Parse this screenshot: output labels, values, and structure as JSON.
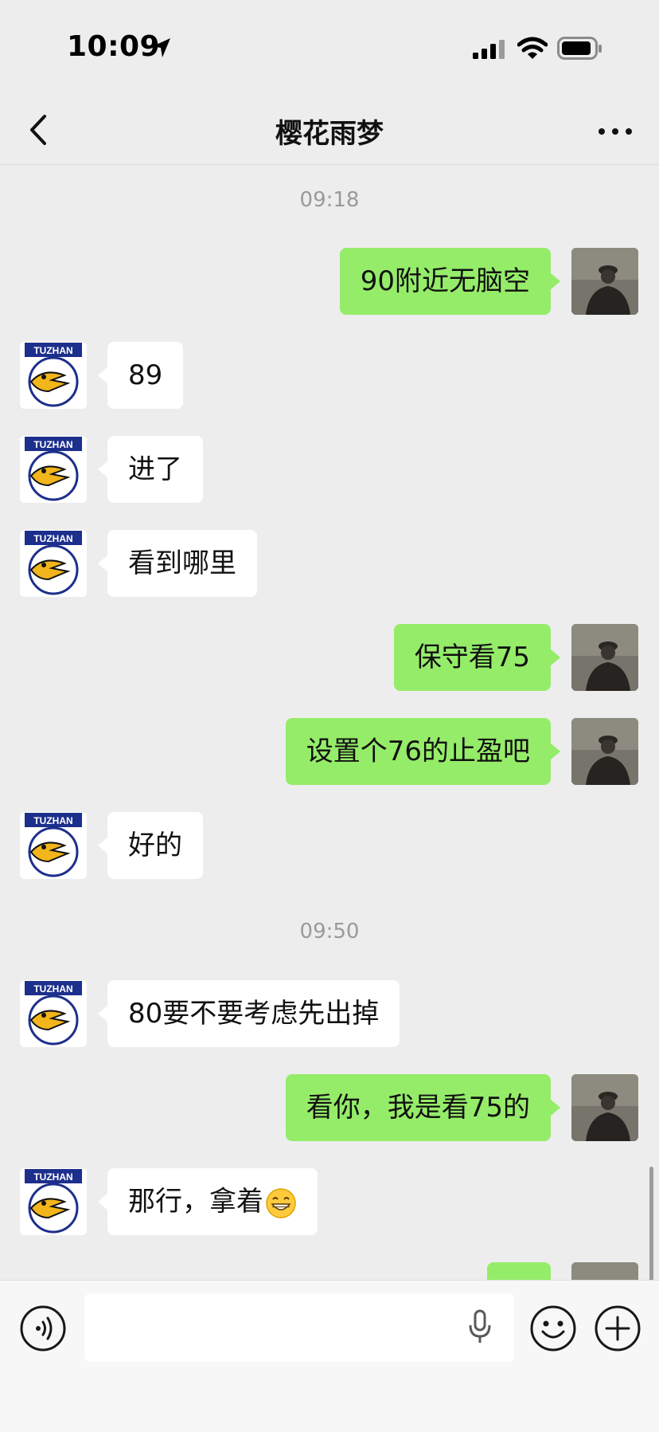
{
  "status": {
    "time": "10:09"
  },
  "header": {
    "title": "樱花雨梦"
  },
  "avatars": {
    "left_label": "TUZHAN"
  },
  "messages": [
    {
      "type": "time",
      "text": "09:18"
    },
    {
      "type": "sent",
      "text": "90附近无脑空"
    },
    {
      "type": "received",
      "text": "89"
    },
    {
      "type": "received",
      "text": "进了"
    },
    {
      "type": "received",
      "text": "看到哪里"
    },
    {
      "type": "sent",
      "text": "保守看75"
    },
    {
      "type": "sent",
      "text": "设置个76的止盈吧"
    },
    {
      "type": "received",
      "text": "好的"
    },
    {
      "type": "time",
      "text": "09:50"
    },
    {
      "type": "received",
      "text": "80要不要考虑先出掉"
    },
    {
      "type": "sent",
      "text": "看你，我是看75的"
    },
    {
      "type": "received",
      "text": "那行，拿着",
      "emoji": "grinning-face-with-smiling-eyes"
    }
  ],
  "input": {
    "placeholder": ""
  },
  "colors": {
    "sent_bubble": "#95EC69",
    "received_bubble": "#FFFFFF",
    "background": "#EDEDED"
  },
  "icons": [
    "location-arrow-icon",
    "signal-icon",
    "wifi-icon",
    "battery-icon",
    "back-chevron-icon",
    "more-dots-icon",
    "voice-icon",
    "mic-icon",
    "emoji-icon",
    "plus-icon"
  ]
}
